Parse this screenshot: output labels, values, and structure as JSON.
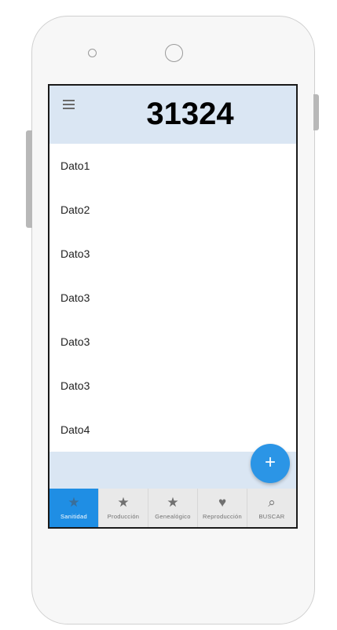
{
  "header": {
    "title": "31324"
  },
  "list": {
    "items": [
      "Dato1",
      "Dato2",
      "Dato3",
      "Dato3",
      "Dato3",
      "Dato3",
      "Dato4"
    ]
  },
  "fab": {
    "icon": "plus-icon",
    "label": "+"
  },
  "nav": {
    "items": [
      {
        "label": "Sanitidad",
        "icon": "star-icon",
        "glyph": "★",
        "active": true
      },
      {
        "label": "Producción",
        "icon": "star-icon",
        "glyph": "★",
        "active": false
      },
      {
        "label": "Genealógico",
        "icon": "star-icon",
        "glyph": "★",
        "active": false
      },
      {
        "label": "Reproducción",
        "icon": "heart-icon",
        "glyph": "♥",
        "active": false
      },
      {
        "label": "BUSCAR",
        "icon": "search-icon",
        "glyph": "⌕",
        "active": false
      }
    ]
  },
  "colors": {
    "header_bg": "#dae6f3",
    "accent": "#2b95e6",
    "active_tab": "#1f8ee4"
  }
}
